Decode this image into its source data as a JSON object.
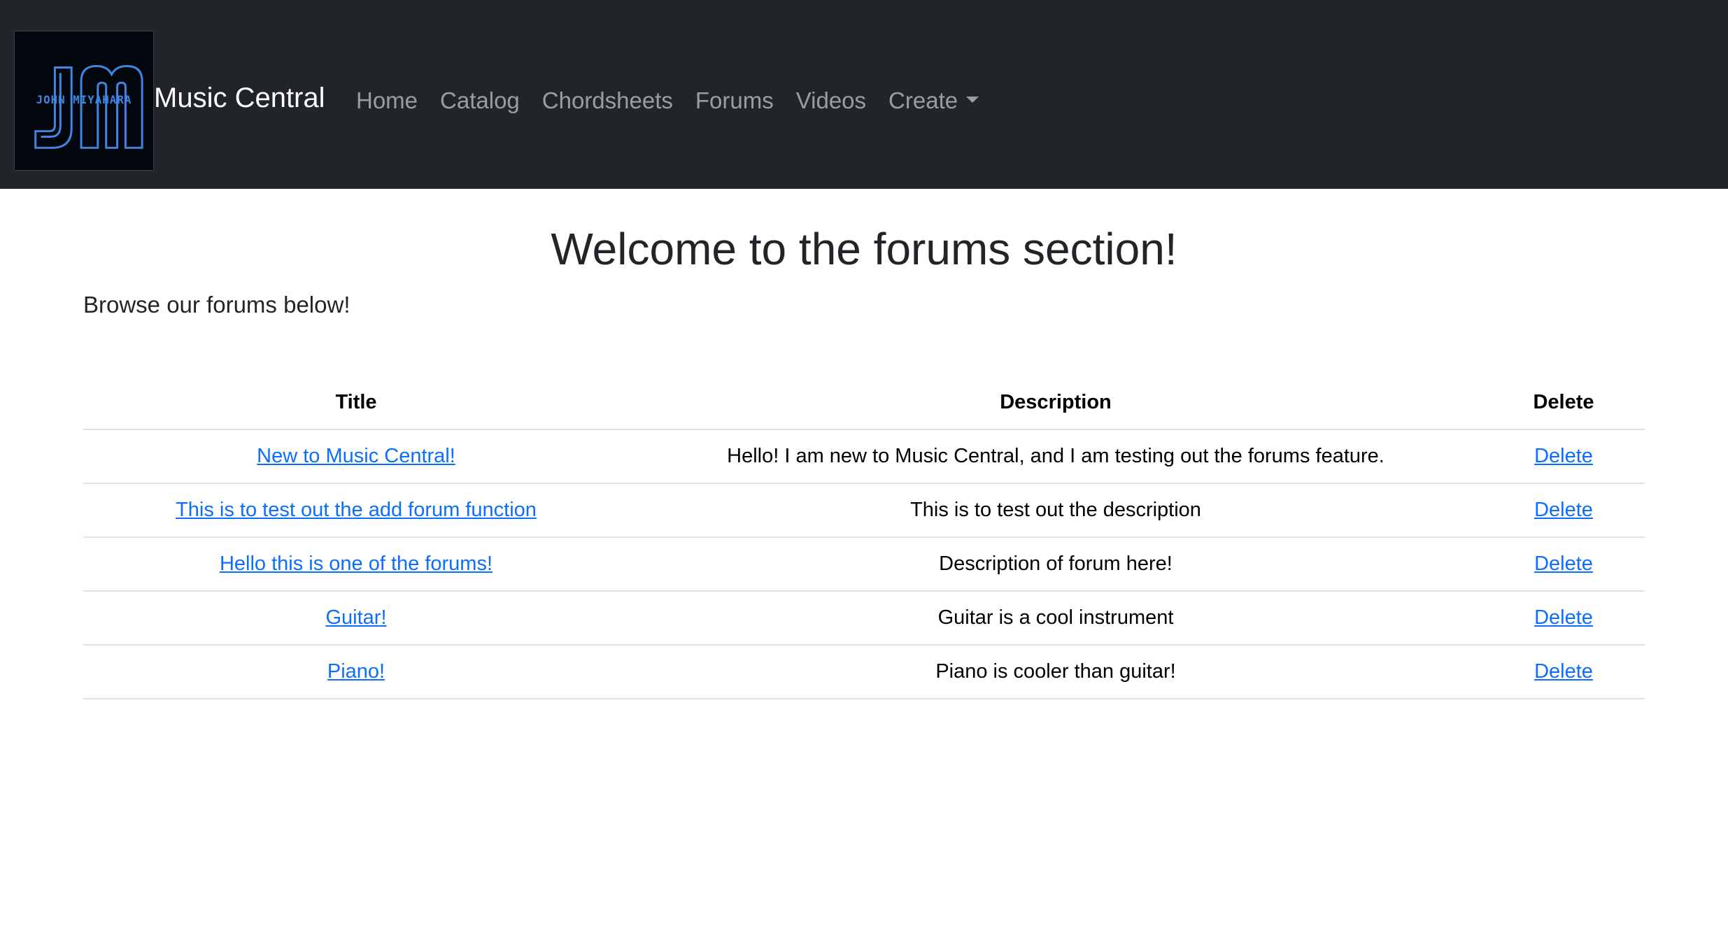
{
  "navbar": {
    "logo_text": "JOHN MIYAHARA",
    "brand": "Music Central",
    "links": [
      {
        "label": "Home"
      },
      {
        "label": "Catalog"
      },
      {
        "label": "Chordsheets"
      },
      {
        "label": "Forums"
      },
      {
        "label": "Videos"
      },
      {
        "label": "Create"
      }
    ]
  },
  "main": {
    "heading": "Welcome to the forums section!",
    "subtext": "Browse our forums below!"
  },
  "table": {
    "headers": [
      "Title",
      "Description",
      "Delete"
    ],
    "rows": [
      {
        "title": "New to Music Central!",
        "description": "Hello! I am new to Music Central, and I am testing out the forums feature.",
        "action": "Delete"
      },
      {
        "title": "This is to test out the add forum function",
        "description": "This is to test out the description",
        "action": "Delete"
      },
      {
        "title": "Hello this is one of the forums!",
        "description": "Description of forum here!",
        "action": "Delete"
      },
      {
        "title": "Guitar!",
        "description": "Guitar is a cool instrument",
        "action": "Delete"
      },
      {
        "title": "Piano!",
        "description": "Piano is cooler than guitar!",
        "action": "Delete"
      }
    ]
  },
  "colors": {
    "navbar_bg": "#212529",
    "link": "#0d6efd",
    "logo_stroke": "#3f86e0"
  }
}
